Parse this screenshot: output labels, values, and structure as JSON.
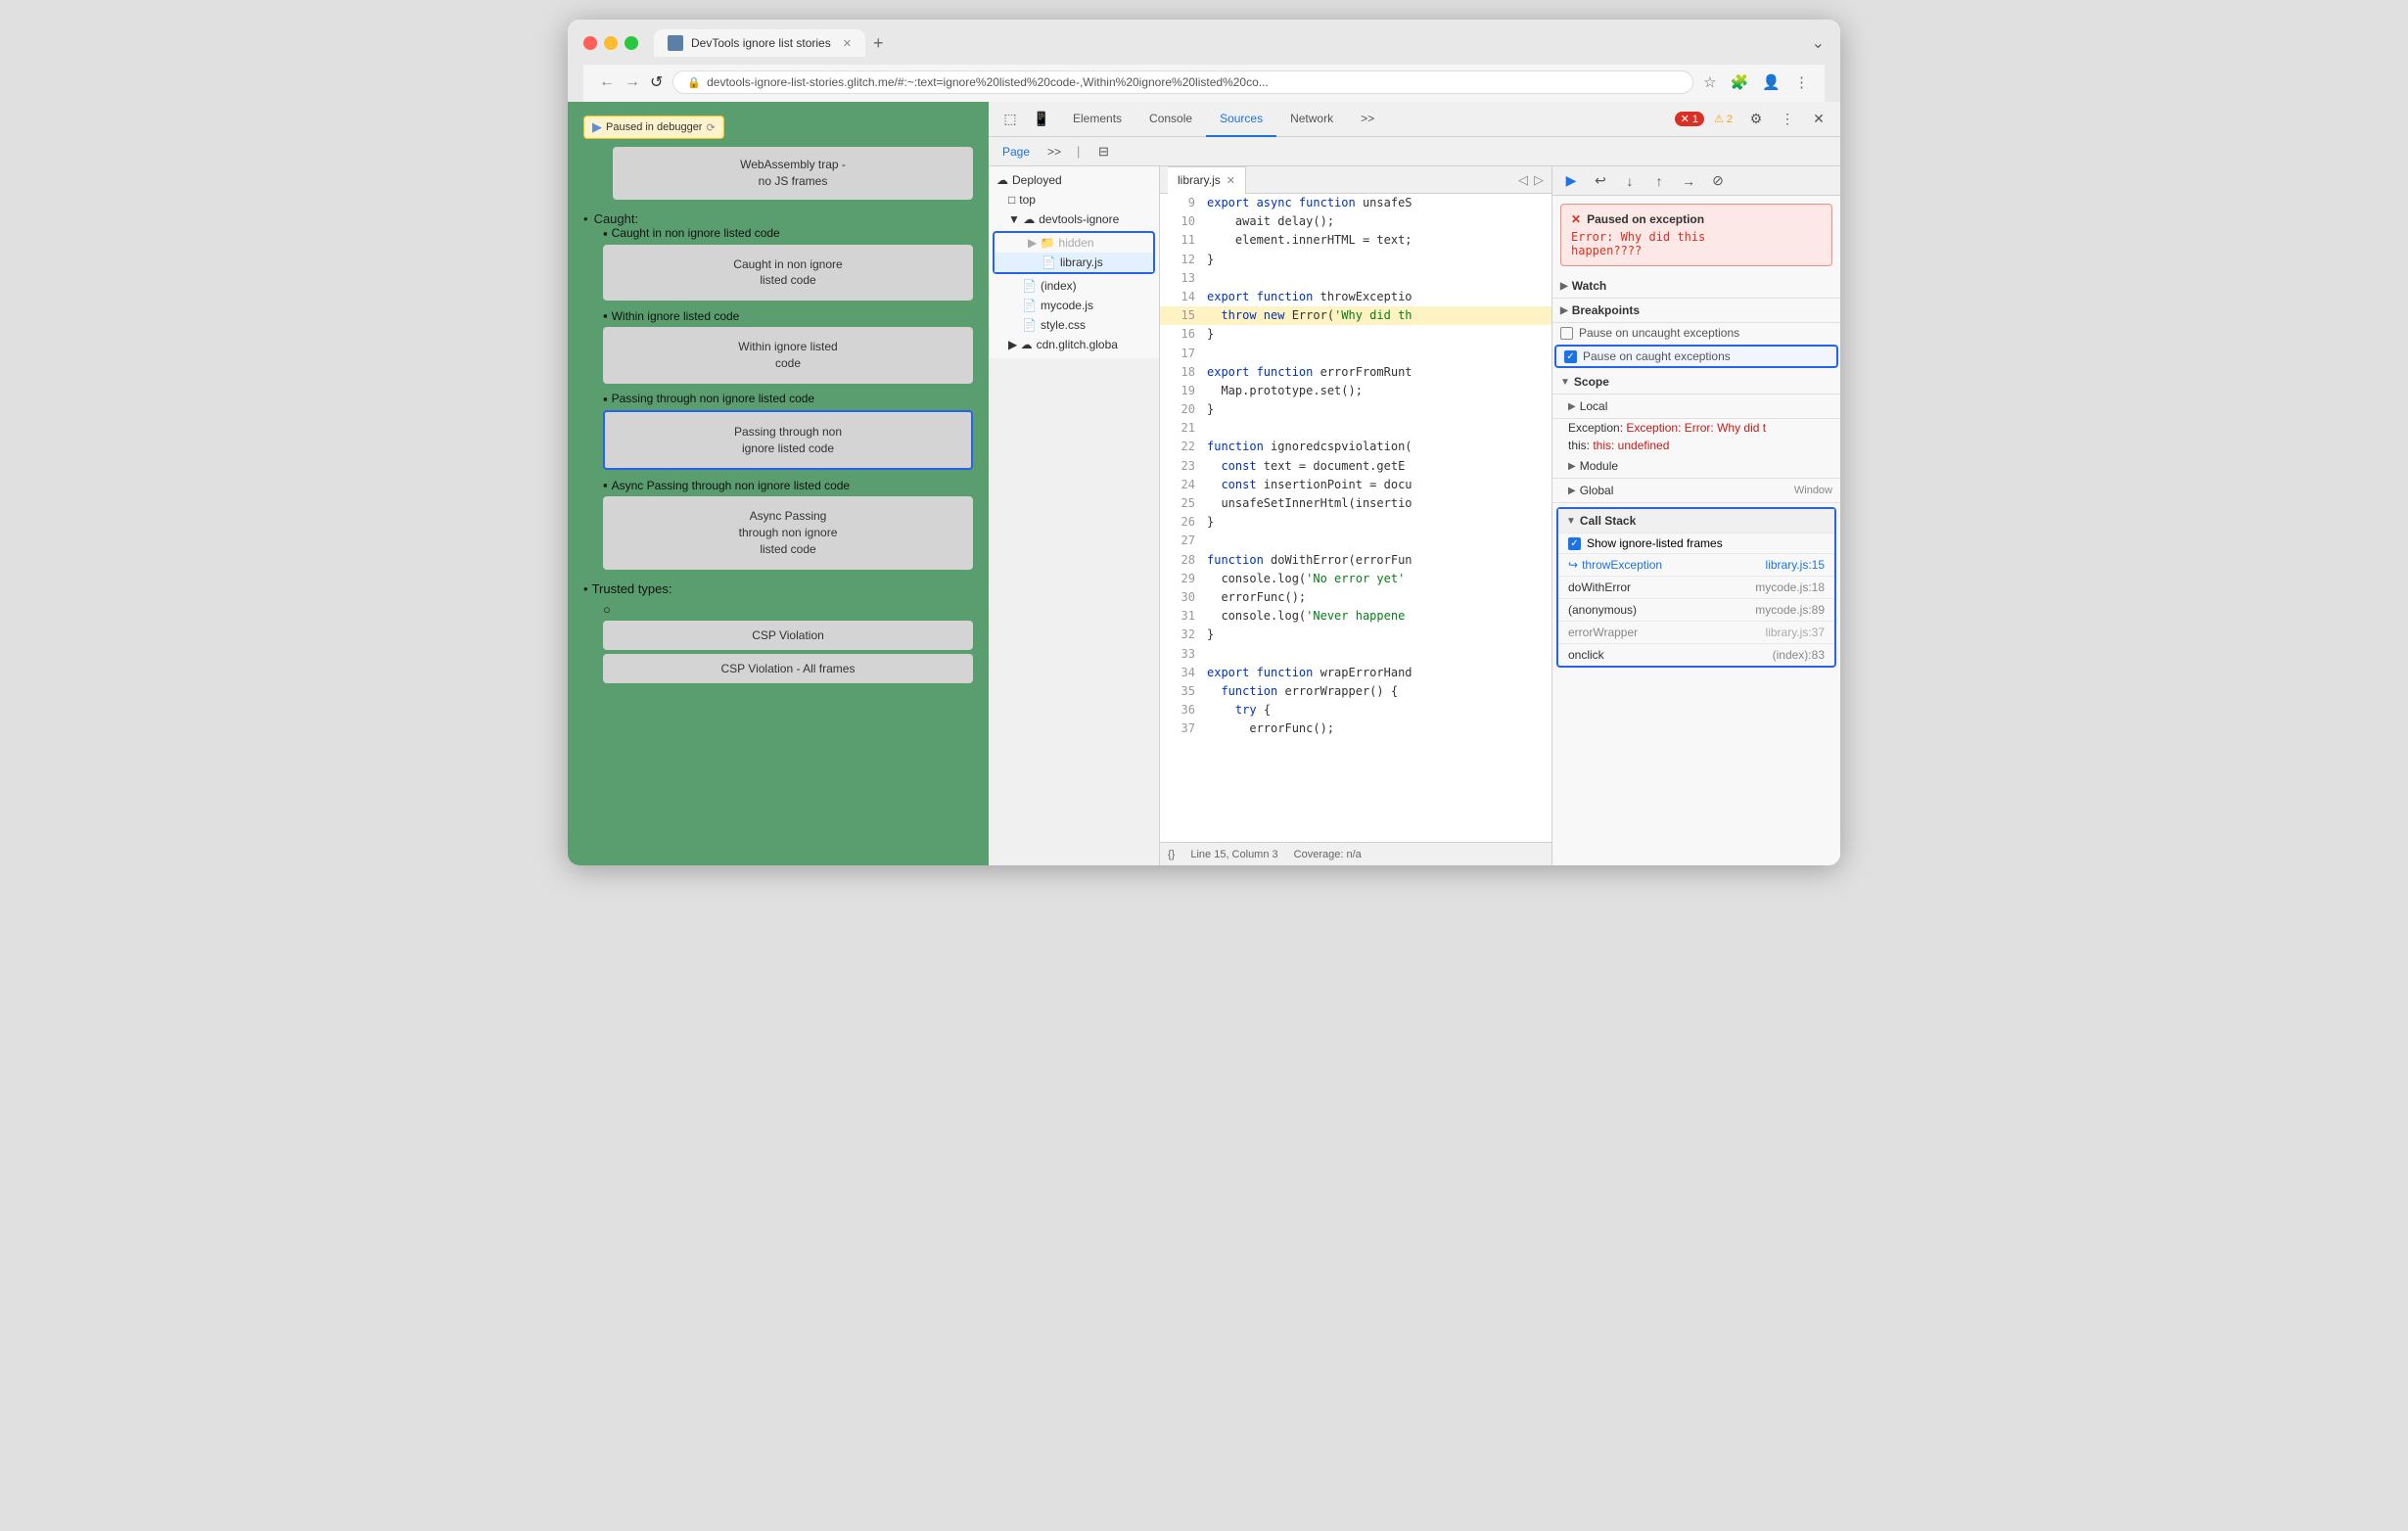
{
  "browser": {
    "tab_title": "DevTools ignore list stories",
    "url": "devtools-ignore-list-stories.glitch.me/#:~:text=ignore%20listed%20code-,Within%20ignore%20listed%20co...",
    "nav": {
      "back": "←",
      "forward": "→",
      "reload": "↺"
    }
  },
  "left_panel": {
    "paused_badge": "Paused in debugger",
    "webassembly_box": "WebAssembly trap -\nno JS frames",
    "caught_label": "Caught:",
    "items": [
      {
        "label": "Caught in non ignore listed code",
        "box_label": "Caught in non ignore\nlisted code",
        "highlighted": false
      },
      {
        "label": "Within ignore listed code",
        "box_label": "Within ignore listed\ncode",
        "highlighted": false
      },
      {
        "label": "Passing through non ignore listed code",
        "box_label": "Passing through non\nignore listed code",
        "highlighted": true
      },
      {
        "label": "Async Passing through non ignore listed code",
        "box_label": "Async Passing\nthrough non ignore\nlisted code",
        "highlighted": false
      }
    ],
    "trusted_label": "Trusted types:",
    "csp_buttons": [
      "CSP Violation",
      "CSP Violation - All frames"
    ]
  },
  "devtools": {
    "toolbar_tabs": [
      "Elements",
      "Console",
      "Sources",
      "Network"
    ],
    "active_tab": "Sources",
    "error_count": "1",
    "warning_count": "2",
    "file_tree": {
      "deployed_label": "Deployed",
      "top_label": "top",
      "root_label": "devtools-ignore",
      "hidden_folder": "hidden",
      "library_file": "library.js",
      "index_file": "(index)",
      "mycode_file": "mycode.js",
      "style_file": "style.css",
      "cdn_label": "cdn.glitch.globa"
    },
    "open_file": "library.js",
    "code_lines": [
      {
        "num": 9,
        "content": "  export async function unsafeS"
      },
      {
        "num": 10,
        "content": "    await delay();"
      },
      {
        "num": 11,
        "content": "    element.innerHTML = text;"
      },
      {
        "num": 12,
        "content": "}"
      },
      {
        "num": 13,
        "content": ""
      },
      {
        "num": 14,
        "content": "export function throwExceptio",
        "kw": true
      },
      {
        "num": 15,
        "content": "  throw new Error('Why did th",
        "highlighted": true
      },
      {
        "num": 16,
        "content": "}"
      },
      {
        "num": 17,
        "content": ""
      },
      {
        "num": 18,
        "content": "export function errorFromRunt"
      },
      {
        "num": 19,
        "content": "  Map.prototype.set();"
      },
      {
        "num": 20,
        "content": "}"
      },
      {
        "num": 21,
        "content": ""
      },
      {
        "num": 22,
        "content": "function ignoredcspviolation("
      },
      {
        "num": 23,
        "content": "  const text = document.getE"
      },
      {
        "num": 24,
        "content": "  const insertionPoint = docu"
      },
      {
        "num": 25,
        "content": "  unsafeSetInnerHtml(insertio"
      },
      {
        "num": 26,
        "content": "}"
      },
      {
        "num": 27,
        "content": ""
      },
      {
        "num": 28,
        "content": "function doWithError(errorFun"
      },
      {
        "num": 29,
        "content": "  console.log('No error yet'"
      },
      {
        "num": 30,
        "content": "  errorFunc();"
      },
      {
        "num": 31,
        "content": "  console.log('Never happene"
      },
      {
        "num": 32,
        "content": "}"
      },
      {
        "num": 33,
        "content": ""
      },
      {
        "num": 34,
        "content": "export function wrapErrorHand"
      },
      {
        "num": 35,
        "content": "  function errorWrapper() {"
      },
      {
        "num": 36,
        "content": "    try {"
      },
      {
        "num": 37,
        "content": "      errorFunc();"
      }
    ],
    "status_bar": {
      "line_col": "Line 15, Column 3",
      "coverage": "Coverage: n/a"
    },
    "right_panel": {
      "exception_title": "Paused on exception",
      "exception_msg": "Error: Why did this\nhappen????",
      "sections": {
        "watch": "Watch",
        "breakpoints": "Breakpoints",
        "pause_uncaught": "Pause on uncaught exceptions",
        "pause_caught": "Pause on caught exceptions",
        "scope": "Scope",
        "local": "Local",
        "exception_local": "Exception: Error: Why did t",
        "this_val": "this: undefined",
        "module": "Module",
        "global": "Global",
        "global_val": "Window",
        "call_stack": "Call Stack",
        "show_ignore": "Show ignore-listed frames"
      },
      "call_stack_items": [
        {
          "fn": "throwException",
          "loc": "library.js:15",
          "active": true
        },
        {
          "fn": "doWithError",
          "loc": "mycode.js:18",
          "active": false
        },
        {
          "fn": "(anonymous)",
          "loc": "mycode.js:89",
          "active": false
        },
        {
          "fn": "errorWrapper",
          "loc": "library.js:37",
          "dimmed": true
        },
        {
          "fn": "onclick",
          "loc": "(index):83",
          "active": false
        }
      ]
    }
  }
}
